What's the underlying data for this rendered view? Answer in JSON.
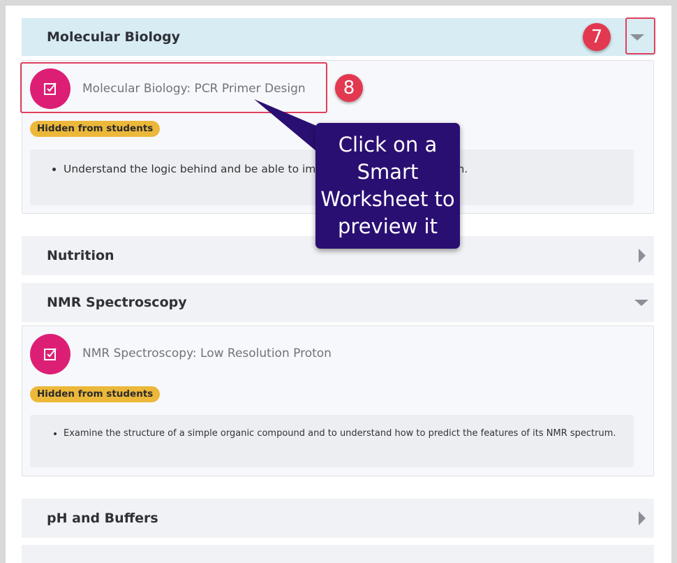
{
  "sections": {
    "molecular_biology": {
      "title": "Molecular Biology",
      "worksheet_title": "Molecular Biology: PCR Primer Design",
      "badge": "Hidden from students",
      "objective": "Understand the logic behind and be able to implement PCR primer design."
    },
    "nutrition": {
      "title": "Nutrition"
    },
    "nmr": {
      "title": "NMR Spectroscopy",
      "worksheet_title": "NMR Spectroscopy: Low Resolution Proton",
      "badge": "Hidden from students",
      "objective": "Examine the structure of a simple organic compound and to understand how to predict the features of its NMR spectrum."
    },
    "ph_buffers": {
      "title": "pH and Buffers"
    }
  },
  "annotations": {
    "step7": "7",
    "step8": "8",
    "callout": "Click on a Smart Worksheet to preview it"
  },
  "icons": {
    "worksheet": "checkbox-icon",
    "expanded": "chevron-down-icon",
    "collapsed": "chevron-right-icon"
  },
  "colors": {
    "accent_pink": "#dc1f75",
    "badge_yellow": "#ecb83a",
    "callout_purple": "#2a0f73",
    "step_red": "#e23950"
  }
}
